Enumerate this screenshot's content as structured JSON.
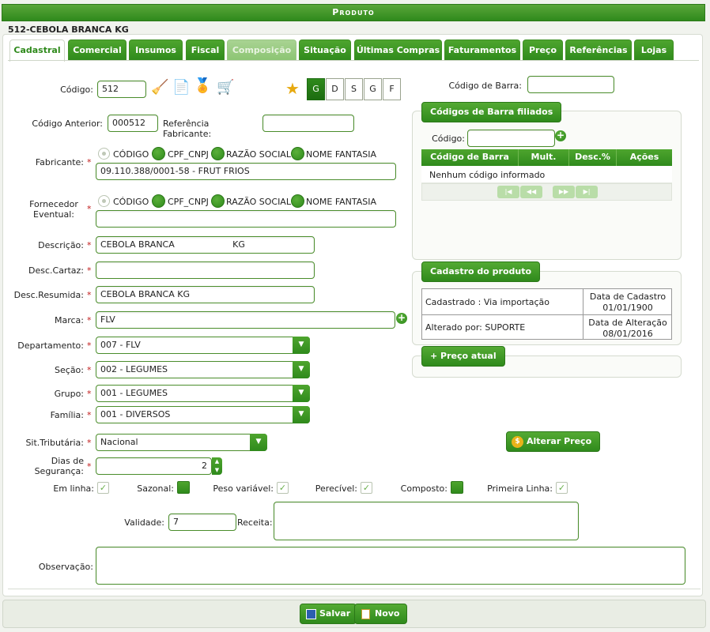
{
  "window_title": "Produto",
  "product_header": "512-CEBOLA BRANCA KG",
  "tabs": [
    "Cadastral",
    "Comercial",
    "Insumos",
    "Fiscal",
    "Composição",
    "Situação",
    "Últimas Compras",
    "Faturamentos",
    "Preço",
    "Referências",
    "Lojas"
  ],
  "codigo": {
    "label": "Código:",
    "value": "512"
  },
  "classes": [
    "G",
    "D",
    "S",
    "G",
    "F"
  ],
  "codigo_anterior": {
    "label": "Código Anterior:",
    "value": "000512"
  },
  "ref_fabricante": {
    "label": "Referência Fabricante:",
    "value": ""
  },
  "search_options": [
    "CÓDIGO",
    "CPF_CNPJ",
    "RAZÃO SOCIAL",
    "NOME FANTASIA"
  ],
  "fabricante": {
    "label": "Fabricante:",
    "value": "09.110.388/0001-58 - FRUT FRIOS"
  },
  "fornecedor": {
    "label_line1": "Fornecedor",
    "label_line2": "Eventual:",
    "value": ""
  },
  "descricao": {
    "label": "Descrição:",
    "value": "CEBOLA BRANCA                     KG"
  },
  "desc_cartaz": {
    "label": "Desc.Cartaz:",
    "value": ""
  },
  "desc_resumida": {
    "label": "Desc.Resumida:",
    "value": "CEBOLA BRANCA KG"
  },
  "marca": {
    "label": "Marca:",
    "value": "FLV"
  },
  "departamento": {
    "label": "Departamento:",
    "value": "007 - FLV"
  },
  "secao": {
    "label": "Seção:",
    "value": "002 - LEGUMES"
  },
  "grupo": {
    "label": "Grupo:",
    "value": "001 - LEGUMES"
  },
  "familia": {
    "label": "Família:",
    "value": "001 - DIVERSOS"
  },
  "sit_tributaria": {
    "label": "Sit.Tributária:",
    "value": "Nacional"
  },
  "dias_seguranca": {
    "label_line1": "Dias de",
    "label_line2": "Segurança:",
    "value": "2"
  },
  "checks": {
    "em_linha": "Em linha:",
    "sazonal": "Sazonal:",
    "peso_variavel": "Peso variável:",
    "perecivel": "Perecível:",
    "composto": "Composto:",
    "primeira_linha": "Primeira Linha:"
  },
  "validade": {
    "label": "Validade:",
    "value": "7"
  },
  "receita": {
    "label": "Receita:",
    "value": ""
  },
  "observacao": {
    "label": "Observação:",
    "value": ""
  },
  "codigo_barra": {
    "label": "Código de Barra:",
    "value": ""
  },
  "barcodes_box": {
    "title": "Códigos de Barra filiados",
    "codigo_label": "Código:",
    "columns": [
      "Código de Barra",
      "Mult.",
      "Desc.%",
      "Ações"
    ],
    "empty_text": "Nenhum código informado",
    "pager": [
      "|◀",
      "◀◀",
      "▶▶",
      "▶|"
    ]
  },
  "cadastro_box": {
    "title": "Cadastro do produto",
    "cadastrado": "Cadastrado : Via importação",
    "data_cadastro_label": "Data de Cadastro",
    "data_cadastro": "01/01/1900",
    "alterado": "Alterado por: SUPORTE",
    "data_alteracao_label": "Data de Alteração",
    "data_alteracao": "08/01/2016"
  },
  "preco_atual_label": "Preço atual",
  "alterar_preco_label": "Alterar Preço",
  "salvar_label": "Salvar",
  "novo_label": "Novo",
  "colors": {
    "accent": "#2f8a1c",
    "required": "#c01c1c"
  }
}
